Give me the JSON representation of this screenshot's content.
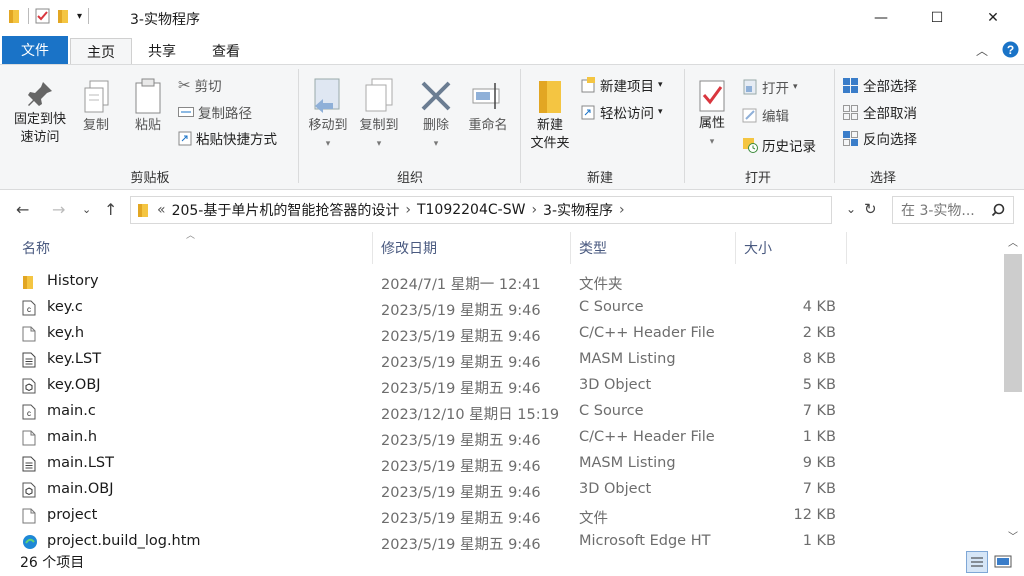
{
  "window": {
    "title": "3-实物程序",
    "controls": {
      "minimize": "—",
      "maximize": "☐",
      "close": "✕"
    }
  },
  "tabs": [
    {
      "label": "文件"
    },
    {
      "label": "主页"
    },
    {
      "label": "共享"
    },
    {
      "label": "查看"
    }
  ],
  "ribbon": {
    "clipboard": {
      "pin_line1": "固定到快",
      "pin_line2": "速访问",
      "copy": "复制",
      "paste": "粘贴",
      "cut": "剪切",
      "copy_path": "复制路径",
      "paste_shortcut": "粘贴快捷方式",
      "label": "剪贴板"
    },
    "organize": {
      "move_to": "移动到",
      "copy_to": "复制到",
      "delete": "删除",
      "rename": "重命名",
      "label": "组织"
    },
    "new": {
      "new_folder_line1": "新建",
      "new_folder_line2": "文件夹",
      "new_item": "新建项目",
      "easy_access": "轻松访问",
      "label": "新建"
    },
    "open": {
      "properties": "属性",
      "open": "打开",
      "edit": "编辑",
      "history": "历史记录",
      "label": "打开"
    },
    "select": {
      "select_all": "全部选择",
      "select_none": "全部取消",
      "invert": "反向选择",
      "label": "选择"
    }
  },
  "address": {
    "prefix": "«",
    "crumbs": [
      "205-基于单片机的智能抢答器的设计",
      "T1092204C-SW",
      "3-实物程序"
    ],
    "search_placeholder": "在 3-实物..."
  },
  "columns": {
    "name": "名称",
    "date": "修改日期",
    "type": "类型",
    "size": "大小"
  },
  "files": [
    {
      "name": "History",
      "date": "2024/7/1 星期一 12:41",
      "type": "文件夹",
      "size": "",
      "icon": "folder-icon"
    },
    {
      "name": "key.c",
      "date": "2023/5/19 星期五 9:46",
      "type": "C Source",
      "size": "4 KB",
      "icon": "c-source-icon"
    },
    {
      "name": "key.h",
      "date": "2023/5/19 星期五 9:46",
      "type": "C/C++ Header File",
      "size": "2 KB",
      "icon": "file-icon"
    },
    {
      "name": "key.LST",
      "date": "2023/5/19 星期五 9:46",
      "type": "MASM Listing",
      "size": "8 KB",
      "icon": "listing-icon"
    },
    {
      "name": "key.OBJ",
      "date": "2023/5/19 星期五 9:46",
      "type": "3D Object",
      "size": "5 KB",
      "icon": "3d-object-icon"
    },
    {
      "name": "main.c",
      "date": "2023/12/10 星期日 15:19",
      "type": "C Source",
      "size": "7 KB",
      "icon": "c-source-icon"
    },
    {
      "name": "main.h",
      "date": "2023/5/19 星期五 9:46",
      "type": "C/C++ Header File",
      "size": "1 KB",
      "icon": "file-icon"
    },
    {
      "name": "main.LST",
      "date": "2023/5/19 星期五 9:46",
      "type": "MASM Listing",
      "size": "9 KB",
      "icon": "listing-icon"
    },
    {
      "name": "main.OBJ",
      "date": "2023/5/19 星期五 9:46",
      "type": "3D Object",
      "size": "7 KB",
      "icon": "3d-object-icon"
    },
    {
      "name": "project",
      "date": "2023/5/19 星期五 9:46",
      "type": "文件",
      "size": "12 KB",
      "icon": "file-icon"
    },
    {
      "name": "project.build_log.htm",
      "date": "2023/5/19 星期五 9:46",
      "type": "Microsoft Edge HT",
      "size": "1 KB",
      "icon": "edge-icon"
    }
  ],
  "status": {
    "count": "26 个项目"
  },
  "colors": {
    "accent": "#1a73c7",
    "folder": "#f4c542"
  }
}
